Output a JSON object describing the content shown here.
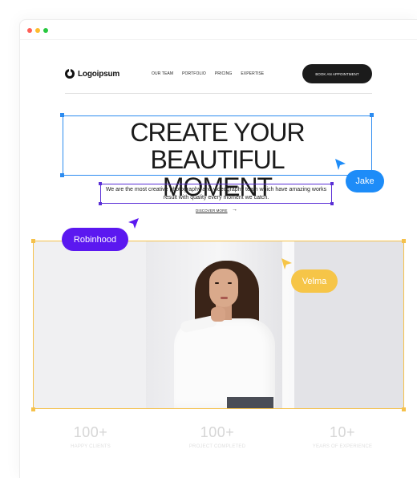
{
  "brand": {
    "logo_text": "Logoipsum"
  },
  "nav": {
    "items": [
      "OUR TEAM",
      "PORTFOLIO",
      "PRICING",
      "EXPERTISE"
    ],
    "cta_label": "BOOK AN APPOINTMENT"
  },
  "hero": {
    "title_line1": "CREATE YOUR BEAUTIFUL",
    "title_line2": "MOMENT",
    "subtitle": "We are the most creative photography and videography team which have amazing works result with quality every moment we catch.",
    "link_label": "DISCOVER MORE",
    "link_arrow": "→"
  },
  "collaborators": [
    {
      "name": "Jake",
      "color": "#1d8cf8"
    },
    {
      "name": "Robinhood",
      "color": "#5b18f0"
    },
    {
      "name": "Velma",
      "color": "#f6c548"
    }
  ],
  "stats": [
    {
      "value": "100+",
      "label": "HAPPY CLIENTS"
    },
    {
      "value": "100+",
      "label": "PROJECT COMPLETED"
    },
    {
      "value": "10+",
      "label": "YEARS OF EXPERIENCE"
    }
  ],
  "colors": {
    "selection_blue": "#2d8cf0",
    "selection_purple": "#5a2fd6",
    "selection_gold": "#f5c14b",
    "cta_background": "#1b1b1b"
  }
}
